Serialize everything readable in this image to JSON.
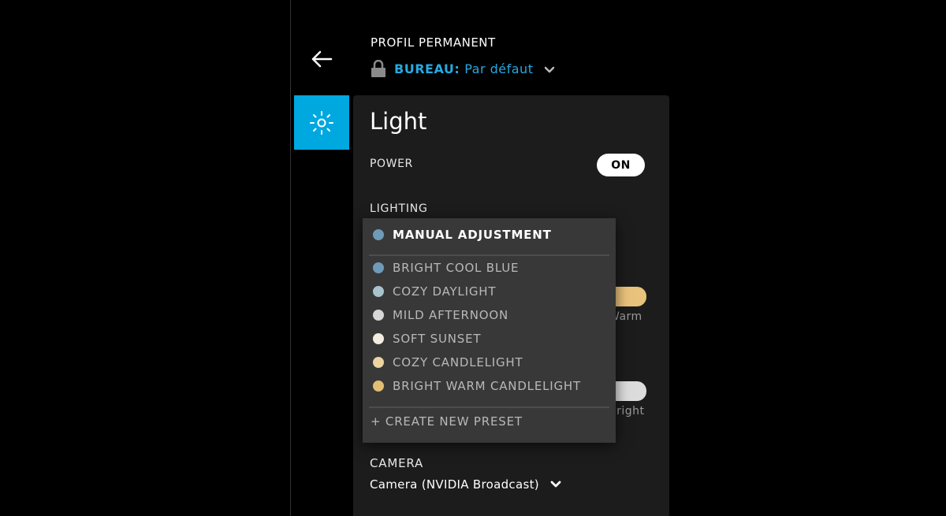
{
  "header": {
    "profile_label": "PROFIL PERMANENT",
    "profile_key": "BUREAU:",
    "profile_value": "Par défaut"
  },
  "panel": {
    "title": "Light",
    "power": {
      "label": "POWER",
      "toggle": "ON"
    },
    "lighting": {
      "label": "LIGHTING"
    },
    "sliders": {
      "warm_caption": "Warm",
      "bright_caption": "Bright"
    },
    "camera": {
      "label": "CAMERA",
      "value": "Camera (NVIDIA Broadcast)"
    }
  },
  "dropdown": {
    "selected": {
      "label": "MANUAL ADJUSTMENT",
      "color": "#6f9ab8"
    },
    "presets": [
      {
        "label": "BRIGHT COOL BLUE",
        "color": "#6f9ab8"
      },
      {
        "label": "COZY DAYLIGHT",
        "color": "#a9c3cc"
      },
      {
        "label": "MILD AFTERNOON",
        "color": "#d6d6d6"
      },
      {
        "label": "SOFT SUNSET",
        "color": "#f3ece0"
      },
      {
        "label": "COZY CANDLELIGHT",
        "color": "#ecd3a0"
      },
      {
        "label": "BRIGHT WARM CANDLELIGHT",
        "color": "#e3bd74"
      }
    ],
    "create_label": "+ CREATE NEW PRESET"
  },
  "colors": {
    "accent": "#00a8e0",
    "link": "#27a9e1",
    "panel_bg": "#1c1c1c",
    "dropdown_bg": "#383838"
  }
}
